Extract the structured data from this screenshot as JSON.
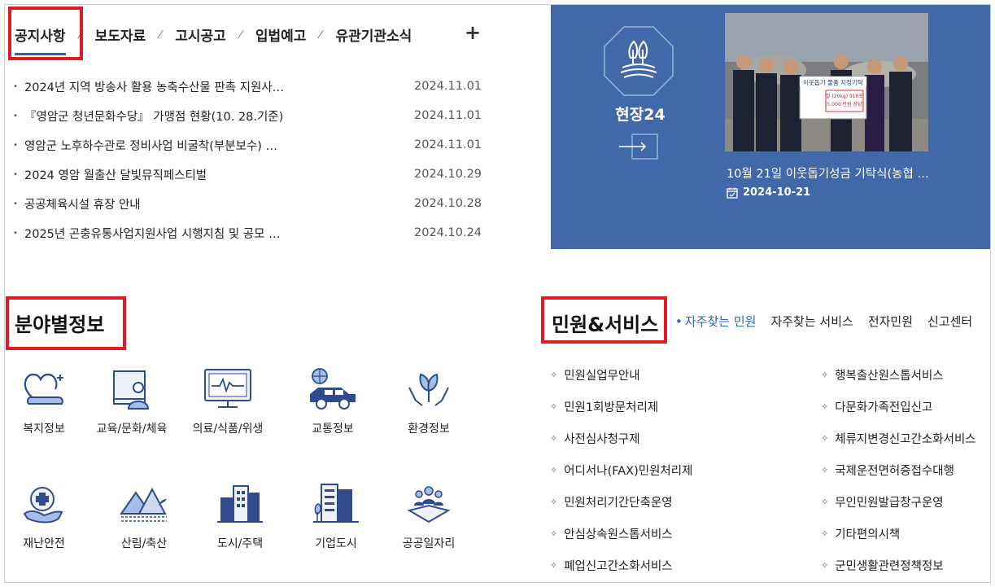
{
  "notice": {
    "tabs": [
      "공지사항",
      "보도자료",
      "고시공고",
      "입법예고",
      "유관기관소식"
    ],
    "more_label": "+",
    "items": [
      {
        "title": "2024년 지역 방송사 활용 농축수산물 판촉 지원사…",
        "date": "2024.11.01"
      },
      {
        "title": "『영암군 청년문화수당』 가맹점 현황(10. 28.기준)",
        "date": "2024.11.01"
      },
      {
        "title": "영암군 노후하수관로 정비사업 비굴착(부분보수) …",
        "date": "2024.11.01"
      },
      {
        "title": "2024 영암 월출산 달빛뮤직페스티벌",
        "date": "2024.10.29"
      },
      {
        "title": "공공체육시설 휴장 안내",
        "date": "2024.10.28"
      },
      {
        "title": "2025년 곤충유통사업지원사업 시행지침 및 공모 …",
        "date": "2024.10.24"
      }
    ]
  },
  "field": {
    "title": "현장24",
    "caption": "10월 21일 이웃돕기성금 기탁식(농협 …",
    "date": "2024-10-21",
    "photo_sign": "이웃돕기 물품 지정기탁",
    "photo_sign_line1": "쌀 (20kg) 910포",
    "photo_sign_line2": "(5,000 만원 상당)"
  },
  "categories": {
    "title": "분야별정보",
    "items": [
      {
        "label": "복지정보",
        "icon": "welfare-icon"
      },
      {
        "label": "교육/문화/체육",
        "icon": "education-icon"
      },
      {
        "label": "의료/식품/위생",
        "icon": "medical-icon"
      },
      {
        "label": "교통정보",
        "icon": "traffic-icon"
      },
      {
        "label": "환경정보",
        "icon": "environment-icon"
      },
      {
        "label": "재난안전",
        "icon": "disaster-icon"
      },
      {
        "label": "산림/축산",
        "icon": "forest-icon"
      },
      {
        "label": "도시/주택",
        "icon": "city-icon"
      },
      {
        "label": "기업도시",
        "icon": "enterprise-icon"
      },
      {
        "label": "공공일자리",
        "icon": "jobs-icon"
      }
    ]
  },
  "services": {
    "title": "민원&서비스",
    "tabs": [
      "자주찾는 민원",
      "자주찾는 서비스",
      "전자민원",
      "신고센터"
    ],
    "left": [
      "민원실업무안내",
      "민원1회방문처리제",
      "사전심사청구제",
      "어디서나(FAX)민원처리제",
      "민원처리기간단축운영",
      "안심상속원스톱서비스",
      "폐업신고간소화서비스"
    ],
    "right": [
      "행복출산원스톱서비스",
      "다문화가족전입신고",
      "체류지변경신고간소화서비스",
      "국제운전면허증접수대행",
      "무인민원발급창구운영",
      "기타편의시책",
      "군민생활관련정책정보"
    ]
  },
  "colors": {
    "accent": "#2c64b8",
    "panel": "#4169a9",
    "highlight": "#e11a26"
  }
}
